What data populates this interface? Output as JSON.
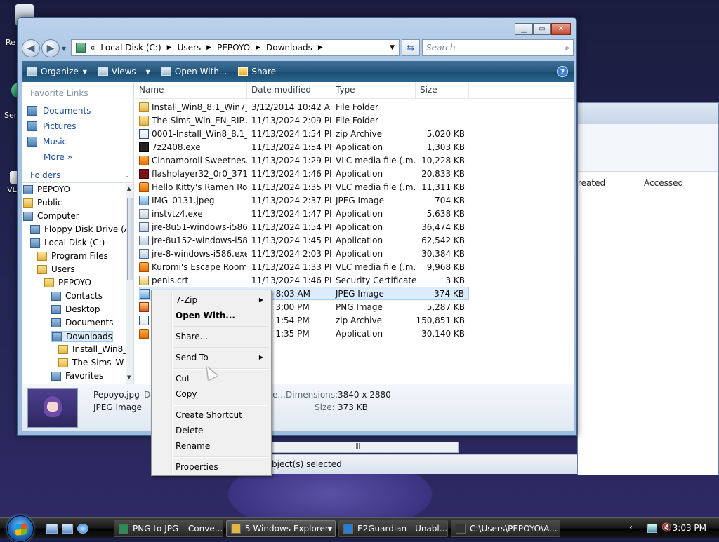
{
  "window": {
    "address": [
      "Local Disk (C:)",
      "Users",
      "PEPOYO",
      "Downloads"
    ],
    "address_prefix": "«",
    "search_placeholder": "Search"
  },
  "toolbar": {
    "organize": "Organize",
    "views": "Views",
    "open_with": "Open With...",
    "share": "Share"
  },
  "favorites": {
    "title": "Favorite Links",
    "items": [
      "Documents",
      "Pictures",
      "Music"
    ],
    "more": "More"
  },
  "folders": {
    "title": "Folders",
    "tree": [
      {
        "label": "PEPOYO",
        "level": 0
      },
      {
        "label": "Public",
        "level": 0
      },
      {
        "label": "Computer",
        "level": 0
      },
      {
        "label": "Floppy Disk Drive (A",
        "level": 1
      },
      {
        "label": "Local Disk (C:)",
        "level": 1
      },
      {
        "label": "Program Files",
        "level": 2
      },
      {
        "label": "Users",
        "level": 2
      },
      {
        "label": "PEPOYO",
        "level": 3
      },
      {
        "label": "Contacts",
        "level": 4
      },
      {
        "label": "Desktop",
        "level": 4
      },
      {
        "label": "Documents",
        "level": 4
      },
      {
        "label": "Downloads",
        "level": 4
      },
      {
        "label": "Install_Win8_",
        "level": 5
      },
      {
        "label": "The-Sims_W",
        "level": 5
      },
      {
        "label": "Favorites",
        "level": 4
      }
    ]
  },
  "columns": [
    "Name",
    "Date modified",
    "Type",
    "Size"
  ],
  "files": [
    {
      "name": "Install_Win8_8.1_Win7_...",
      "date": "3/12/2014 10:42 AM",
      "type": "File Folder",
      "size": "",
      "icon": "folder"
    },
    {
      "name": "The-Sims_Win_EN_RIP...",
      "date": "11/13/2024 2:09 PM",
      "type": "File Folder",
      "size": "",
      "icon": "folder"
    },
    {
      "name": "0001-Install_Win8_8.1_...",
      "date": "11/13/2024 1:54 PM",
      "type": "zip Archive",
      "size": "5,020 KB",
      "icon": "zip"
    },
    {
      "name": "7z2408.exe",
      "date": "11/13/2024 1:54 PM",
      "type": "Application",
      "size": "1,303 KB",
      "icon": "sevenz"
    },
    {
      "name": "Cinnamoroll Sweetnes...",
      "date": "11/13/2024 1:29 PM",
      "type": "VLC media file (.m...",
      "size": "10,228 KB",
      "icon": "vlc"
    },
    {
      "name": "flashplayer32_0r0_371_...",
      "date": "11/13/2024 1:46 PM",
      "type": "Application",
      "size": "20,833 KB",
      "icon": "flash"
    },
    {
      "name": "Hello Kitty's Ramen Ro...",
      "date": "11/13/2024 1:35 PM",
      "type": "VLC media file (.m...",
      "size": "11,311 KB",
      "icon": "vlc"
    },
    {
      "name": "IMG_0131.jpeg",
      "date": "11/13/2024 2:37 PM",
      "type": "JPEG Image",
      "size": "704 KB",
      "icon": "img"
    },
    {
      "name": "instvtz4.exe",
      "date": "11/13/2024 1:47 PM",
      "type": "Application",
      "size": "5,638 KB",
      "icon": "app"
    },
    {
      "name": "jre-8u51-windows-i586...",
      "date": "11/13/2024 1:54 PM",
      "type": "Application",
      "size": "36,474 KB",
      "icon": "java"
    },
    {
      "name": "jre-8u152-windows-i58...",
      "date": "11/13/2024 1:45 PM",
      "type": "Application",
      "size": "62,542 KB",
      "icon": "java"
    },
    {
      "name": "jre-8-windows-i586.exe",
      "date": "11/13/2024 2:03 PM",
      "type": "Application",
      "size": "30,384 KB",
      "icon": "java"
    },
    {
      "name": "Kuromi's Escape Room...",
      "date": "11/13/2024 1:33 PM",
      "type": "VLC media file (.m...",
      "size": "9,968 KB",
      "icon": "vlc"
    },
    {
      "name": "penis.crt",
      "date": "11/13/2024 1:46 PM",
      "type": "Security Certificate",
      "size": "3 KB",
      "icon": "cert"
    },
    {
      "name": "",
      "date": "2024 8:03 AM",
      "type": "JPEG Image",
      "size": "374 KB",
      "icon": "img"
    },
    {
      "name": "",
      "date": "2024 3:00 PM",
      "type": "PNG Image",
      "size": "5,287 KB",
      "icon": "png"
    },
    {
      "name": "",
      "date": "2024 1:54 PM",
      "type": "zip Archive",
      "size": "150,851 KB",
      "icon": "zip"
    },
    {
      "name": "",
      "date": "2024 1:35 PM",
      "type": "Application",
      "size": "30,140 KB",
      "icon": "vlc"
    }
  ],
  "details": {
    "filename": "Pepoyo.jpg",
    "filetype": "JPEG Image",
    "date_label_fragment": "Da",
    "dimensions_prefix": "e...",
    "dimensions_label": "Dimensions:",
    "dimensions_value": "3840 x 2880",
    "size_label": "Size:",
    "size_value": "373 KB"
  },
  "status_text": "bject(s) selected",
  "context_menu": {
    "groups": [
      [
        {
          "label": "7-Zip",
          "submenu": true
        },
        {
          "label": "Open With...",
          "bold": true
        }
      ],
      [
        {
          "label": "Share..."
        }
      ],
      [
        {
          "label": "Send To",
          "submenu": true
        }
      ],
      [
        {
          "label": "Cut"
        },
        {
          "label": "Copy"
        }
      ],
      [
        {
          "label": "Create Shortcut"
        },
        {
          "label": "Delete"
        },
        {
          "label": "Rename"
        }
      ],
      [
        {
          "label": "Properties"
        }
      ]
    ]
  },
  "background_window": {
    "col_created": "reated",
    "col_accessed": "Accessed"
  },
  "desktop": {
    "labels": [
      "Re",
      "Ser",
      "VL"
    ]
  },
  "taskbar": {
    "tasks": [
      {
        "label": "PNG to JPG – Conve...",
        "active": false
      },
      {
        "label": "5 Windows Explorer",
        "active": true
      },
      {
        "label": "E2Guardian - Unabl...",
        "active": false
      },
      {
        "label": "C:\\Users\\PEPOYO\\A...",
        "active": false
      }
    ],
    "clock": "3:03 PM"
  },
  "colors": {
    "toolbar": "#26577e",
    "selection": "#dcecfc",
    "link": "#1a4f96"
  }
}
